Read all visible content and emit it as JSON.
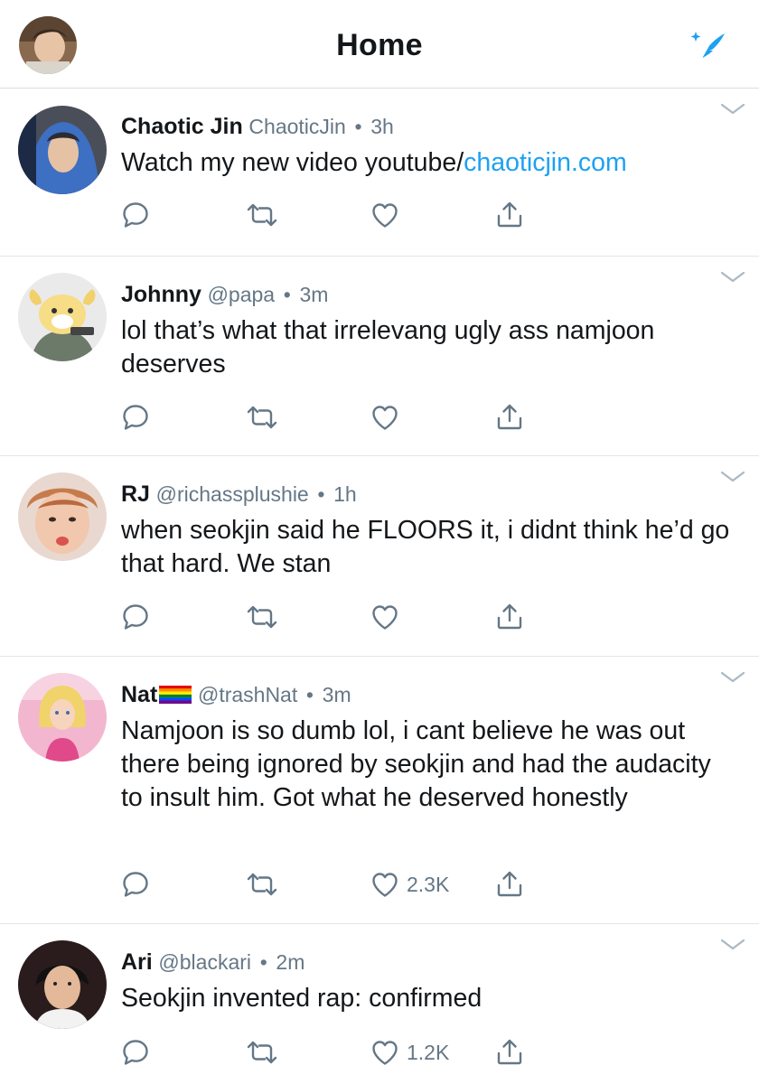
{
  "header": {
    "title": "Home",
    "avatar_icon": "profile-avatar",
    "compose_icon": "sparkle-feather-icon"
  },
  "colors": {
    "accent": "#1da1f2",
    "secondary_text": "#657786",
    "divider": "#e1e6ea"
  },
  "tweets": [
    {
      "name": "Chaotic Jin",
      "handle": "ChaoticJin",
      "time": "3h",
      "text": "Watch my new video youtube/",
      "link": "chaoticjin.com",
      "like_count": ""
    },
    {
      "name": "Johnny",
      "handle": "@papa",
      "time": "3m",
      "text": "lol that’s what that irrelevang ugly ass namjoon deserves",
      "like_count": ""
    },
    {
      "name": "RJ",
      "handle": "@richassplushie",
      "time": "1h",
      "text": "when seokjin said he FLOORS it, i didnt think he’d go that hard. We stan",
      "like_count": ""
    },
    {
      "name": "Nat",
      "name_badge": "rainbow-flag-icon",
      "handle": "@trashNat",
      "time": "3m",
      "text": "Namjoon is so dumb lol, i cant believe he was out there being ignored by seokjin and had the audacity to insult him. Got what he deserved honestly",
      "like_count": "2.3K"
    },
    {
      "name": "Ari",
      "handle": "@blackari",
      "time": "2m",
      "text": "Seokjin invented rap: confirmed",
      "like_count": "1.2K"
    }
  ],
  "separator": "•"
}
